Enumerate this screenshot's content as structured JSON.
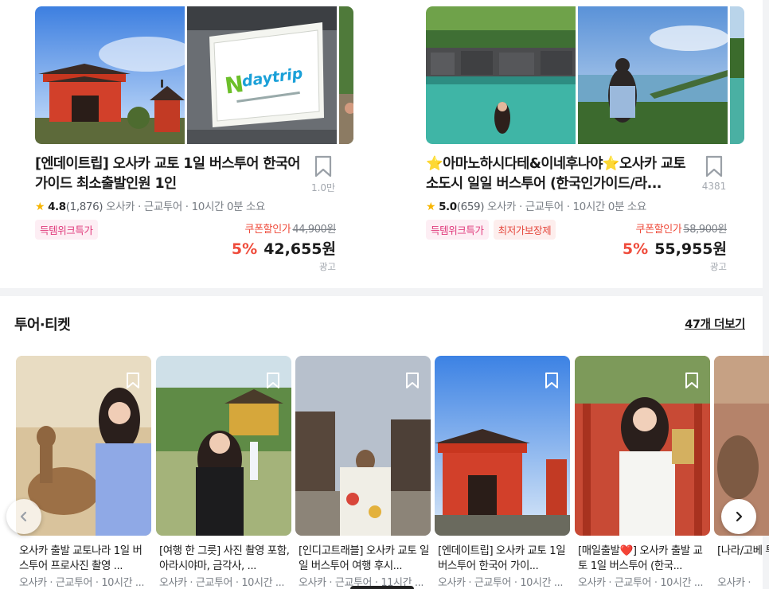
{
  "promos": [
    {
      "title": "[엔데이트립] 오사카 교토 1일 버스투어 한국어 가이드 최소출발인원 1인",
      "bookmark_count": "1.0만",
      "star_icon": "star-icon",
      "rating": "4.8",
      "reviews": "(1,876)",
      "meta": "오사카 · 근교투어 · 10시간 0분 소요",
      "badges": [
        "득템위크특가"
      ],
      "coupon_label": "쿠폰할인가",
      "original_price": "44,900원",
      "discount": "5%",
      "price": "42,655원",
      "ad": "광고",
      "image_sign_text": "Ndaytrip"
    },
    {
      "title": "⭐아마노하시다테&이네후나야⭐오사카 교토 소도시 일일 버스투어 (한국인가이드/라...",
      "bookmark_count": "4381",
      "star_icon": "star-icon",
      "rating": "5.0",
      "reviews": "(659)",
      "meta": "오사카 · 근교투어 · 10시간 0분 소요",
      "badges": [
        "득템위크특가",
        "최저가보장제"
      ],
      "coupon_label": "쿠폰할인가",
      "original_price": "58,900원",
      "discount": "5%",
      "price": "55,955원",
      "ad": "광고"
    }
  ],
  "tour_section": {
    "title": "투어·티켓",
    "more_link": "47개 더보기",
    "cards": [
      {
        "title": "오사카 출발 교토나라 1일 버스투어 프로사진 촬영 ...",
        "meta": "오사카 · 근교투어 · 10시간 ..."
      },
      {
        "title": "[여행 한 그릇] 사진 촬영 포함, 아라시야마, 금각사, ...",
        "meta": "오사카 · 근교투어 · 10시간 ..."
      },
      {
        "title": "[인디고트래블] 오사카 교토 일일 버스투어 여행 후시...",
        "meta": "오사카 · 근교투어 · 11시간 ..."
      },
      {
        "title": "[엔데이트립] 오사카 교토 1일 버스투어 한국어 가이...",
        "meta": "오사카 · 근교투어 · 10시간 ..."
      },
      {
        "title": "[매일출발❤️] 오사카 출발 교토 1일 버스투어 (한국...",
        "meta": "오사카 · 근교투어 · 10시간 ..."
      },
      {
        "title": "[나라/고베 투어 나라",
        "meta": "오사카 · "
      }
    ]
  },
  "colors": {
    "accent_red": "#ef4c3c",
    "badge_pink": "#e03a7c",
    "star": "#f7b500"
  },
  "icons": {
    "bookmark": "bookmark-icon",
    "prev": "chevron-left-icon",
    "next": "chevron-right-icon"
  }
}
